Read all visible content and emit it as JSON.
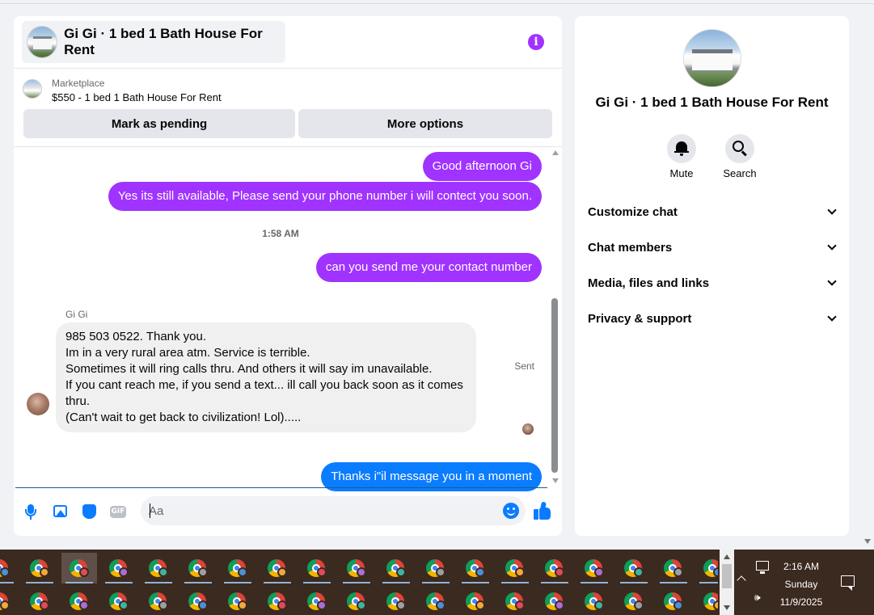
{
  "chat": {
    "title": "Gi Gi · 1 bed 1 Bath House For Rent",
    "marketplace_label": "Marketplace",
    "listing": "$550 - 1 bed 1 Bath House For Rent",
    "btn_pending": "Mark as pending",
    "btn_more": "More options"
  },
  "messages": {
    "m1": "Good afternoon Gi",
    "m2": "Yes its still available, Please send your phone number i will contect you soon.",
    "timestamp": "1:58 AM",
    "m3": "can you send me your contact number",
    "sender": "Gi Gi",
    "incoming_lines": [
      "985 503 0522.  Thank you.",
      "Im in a very rural area atm. Service is terrible.",
      "Sometimes it will ring calls thru. And others it will say im unavailable.",
      "If you cant reach me, if you send a text... ill call you back soon as it comes thru.",
      "(Can't wait to get back to civilization!  Lol)....."
    ],
    "m4": "Thanks i\"il message you in a moment",
    "sent_status": "Sent"
  },
  "composer": {
    "placeholder": "Aa",
    "gif_label": "GIF"
  },
  "details": {
    "title": "Gi Gi · 1 bed 1 Bath House For Rent",
    "mute_label": "Mute",
    "search_label": "Search",
    "sections": [
      "Customize chat",
      "Chat members",
      "Media, files and links",
      "Privacy & support"
    ]
  },
  "taskbar": {
    "time": "2:16 AM",
    "day": "Sunday",
    "date": "11/9/2025",
    "app_icon": "chrome-icon",
    "profile_colors": [
      "#4a90d9",
      "#f2a93b",
      "#e04b5a",
      "#a86fd6",
      "#3bb5a0",
      "#9aa0a6"
    ]
  },
  "colors": {
    "outgoing_purple": "#a033ff",
    "outgoing_blue": "#0a7cff",
    "incoming_gray": "#f0f0f0",
    "accent": "#0a7cff"
  }
}
